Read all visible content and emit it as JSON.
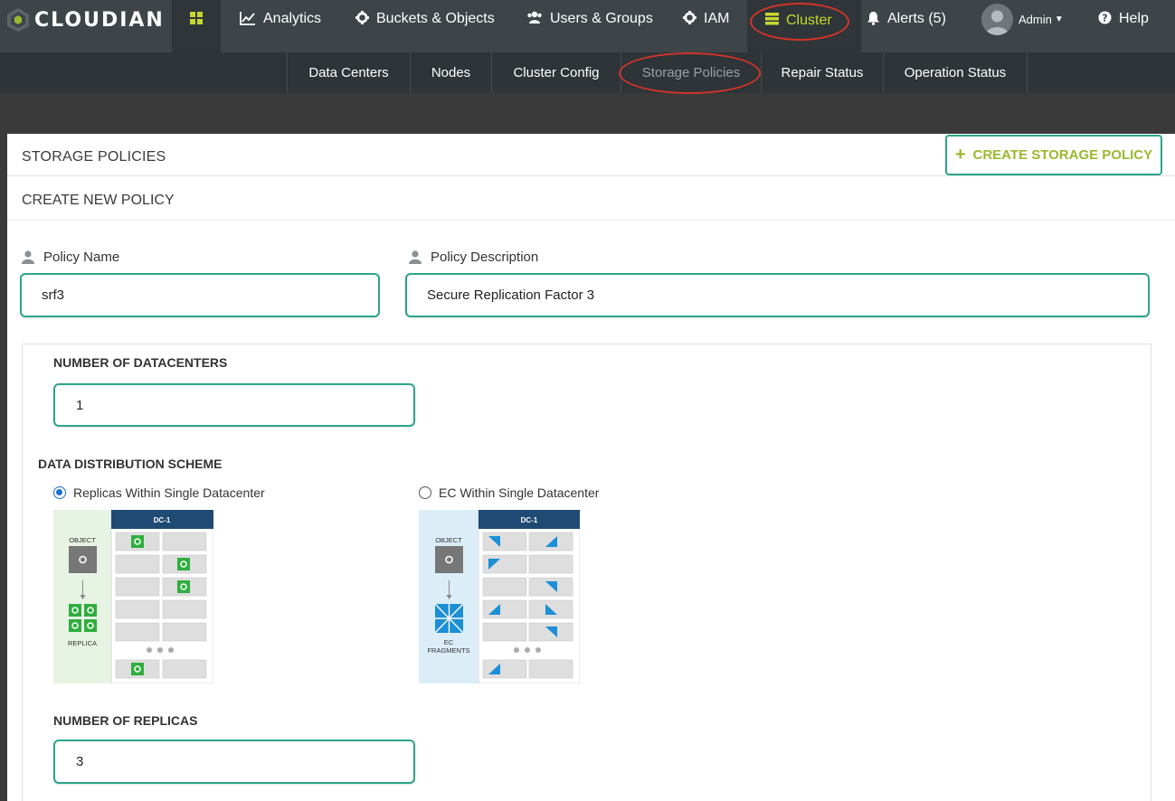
{
  "brand": {
    "name": "CLOUDIAN"
  },
  "topnav": {
    "items": [
      {
        "label": "Analytics",
        "icon": "chart-line-icon"
      },
      {
        "label": "Buckets & Objects",
        "icon": "gear-icon"
      },
      {
        "label": "Users & Groups",
        "icon": "users-icon"
      },
      {
        "label": "IAM",
        "icon": "gear-icon"
      },
      {
        "label": "Cluster",
        "icon": "server-icon"
      },
      {
        "label": "Alerts (5)",
        "icon": "bell-icon"
      },
      {
        "label": "Admin",
        "icon": "avatar"
      },
      {
        "label": "Help",
        "icon": "question-circle-icon"
      }
    ]
  },
  "subnav": {
    "items": [
      {
        "label": "Data Centers"
      },
      {
        "label": "Nodes"
      },
      {
        "label": "Cluster Config"
      },
      {
        "label": "Storage Policies"
      },
      {
        "label": "Repair Status"
      },
      {
        "label": "Operation Status"
      }
    ]
  },
  "page": {
    "title": "STORAGE POLICIES",
    "create_button": "CREATE STORAGE POLICY",
    "subtitle": "CREATE NEW POLICY"
  },
  "form": {
    "policy_name": {
      "label": "Policy Name",
      "value": "srf3"
    },
    "policy_description": {
      "label": "Policy Description",
      "value": "Secure Replication Factor 3"
    },
    "datacenters": {
      "label": "NUMBER OF DATACENTERS",
      "value": "1"
    },
    "distribution": {
      "label": "DATA DISTRIBUTION SCHEME",
      "options": [
        {
          "label": "Replicas Within Single Datacenter",
          "selected": true
        },
        {
          "label": "EC Within Single Datacenter",
          "selected": false
        }
      ]
    },
    "replicas": {
      "label": "NUMBER OF REPLICAS",
      "value": "3"
    }
  },
  "diagrams": {
    "replica": {
      "header": "DC-1",
      "object": "OBJECT",
      "bottom": "REPLICA"
    },
    "ec": {
      "header": "DC-1",
      "object": "OBJECT",
      "bottom_line1": "EC",
      "bottom_line2": "FRAGMENTS"
    }
  },
  "colors": {
    "accent_green": "#2ba58a",
    "brand_lime": "#9ab92f",
    "annotation_red": "#d0342c",
    "nav_bg": "#3e4549",
    "subnav_bg": "#2e3437",
    "diagram_navy": "#1e4a73",
    "replica_green": "#2fae3f",
    "ec_blue": "#1c8fd6"
  }
}
